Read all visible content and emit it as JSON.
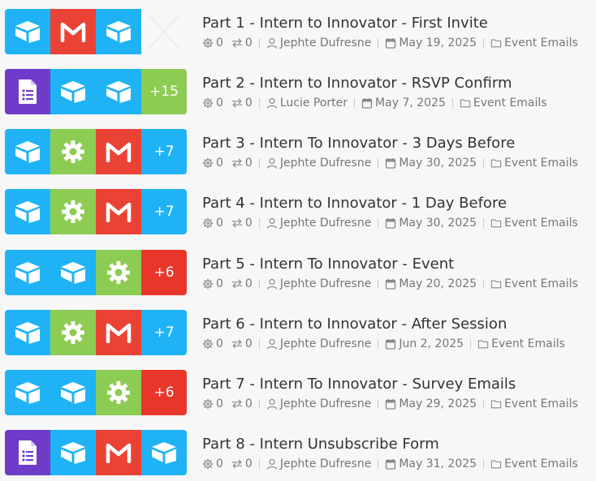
{
  "rows": [
    {
      "title": "Part 1 - Intern to Innovator - First Invite",
      "stat1": "0",
      "stat2": "0",
      "author": "Jephte Dufresne",
      "date": "May 19, 2025",
      "folder": "Event Emails",
      "apps": [
        "airtable",
        "gmail",
        "airtable",
        "empty"
      ],
      "more": ""
    },
    {
      "title": "Part 2 - Intern to Innovator - RSVP Confirm",
      "stat1": "0",
      "stat2": "0",
      "author": "Lucie Porter",
      "date": "May 7, 2025",
      "folder": "Event Emails",
      "apps": [
        "forms",
        "airtable",
        "airtable"
      ],
      "more": "+15",
      "more_color": "#8ccc53"
    },
    {
      "title": "Part 3 - Intern To Innovator - 3 Days Before",
      "stat1": "0",
      "stat2": "0",
      "author": "Jephte Dufresne",
      "date": "May 30, 2025",
      "folder": "Event Emails",
      "apps": [
        "airtable",
        "gear",
        "gmail"
      ],
      "more": "+7",
      "more_color": "#1fb3f5"
    },
    {
      "title": "Part 4 - Intern to Innovator - 1 Day Before",
      "stat1": "0",
      "stat2": "0",
      "author": "Jephte Dufresne",
      "date": "May 30, 2025",
      "folder": "Event Emails",
      "apps": [
        "airtable",
        "gear",
        "gmail"
      ],
      "more": "+7",
      "more_color": "#1fb3f5"
    },
    {
      "title": "Part 5 - Intern To Innovator - Event",
      "stat1": "0",
      "stat2": "0",
      "author": "Jephte Dufresne",
      "date": "May 20, 2025",
      "folder": "Event Emails",
      "apps": [
        "airtable",
        "airtable",
        "gear"
      ],
      "more": "+6",
      "more_color": "#e8372a"
    },
    {
      "title": "Part 6 - Intern to Innovator - After Session",
      "stat1": "0",
      "stat2": "0",
      "author": "Jephte Dufresne",
      "date": "Jun 2, 2025",
      "folder": "Event Emails",
      "apps": [
        "airtable",
        "gear",
        "gmail"
      ],
      "more": "+7",
      "more_color": "#1fb3f5"
    },
    {
      "title": "Part 7 - Intern To Innovator - Survey Emails",
      "stat1": "0",
      "stat2": "0",
      "author": "Jephte Dufresne",
      "date": "May 29, 2025",
      "folder": "Event Emails",
      "apps": [
        "airtable",
        "airtable",
        "gear"
      ],
      "more": "+6",
      "more_color": "#e8372a"
    },
    {
      "title": "Part 8 - Intern Unsubscribe Form",
      "stat1": "0",
      "stat2": "0",
      "author": "Jephte Dufresne",
      "date": "May 31, 2025",
      "folder": "Event Emails",
      "apps": [
        "forms",
        "airtable",
        "gmail",
        "airtable"
      ],
      "more": ""
    }
  ],
  "icons": {
    "airtable": "airtable-icon",
    "gmail": "gmail-icon",
    "forms": "google-forms-icon",
    "gear": "gear-icon",
    "stat1": "gear-stat-icon",
    "stat2": "swap-arrows-icon",
    "author": "user-icon",
    "date": "calendar-icon",
    "folder": "folder-icon"
  },
  "colors": {
    "airtable": "#1fb3f5",
    "gmail": "#ea4335",
    "forms": "#6f3cc9",
    "gear": "#8ccc53"
  }
}
